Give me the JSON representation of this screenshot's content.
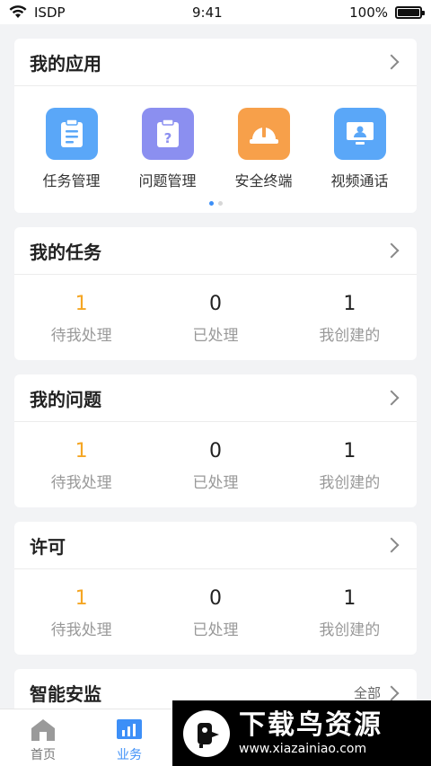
{
  "status": {
    "carrier": "ISDP",
    "time": "9:41",
    "battery": "100%"
  },
  "apps_card": {
    "title": "我的应用",
    "apps": [
      {
        "label": "任务管理",
        "icon": "clipboard-list-icon",
        "color": "#5aa7f8"
      },
      {
        "label": "问题管理",
        "icon": "clipboard-question-icon",
        "color": "#8b8ff0"
      },
      {
        "label": "安全终端",
        "icon": "hard-hat-icon",
        "color": "#f7a04a"
      },
      {
        "label": "视频通话",
        "icon": "monitor-user-icon",
        "color": "#5aa7f8"
      }
    ],
    "page_count": 2,
    "active_page": 0
  },
  "tasks_card": {
    "title": "我的任务",
    "stats": [
      {
        "value": "1",
        "label": "待我处理"
      },
      {
        "value": "0",
        "label": "已处理"
      },
      {
        "value": "1",
        "label": "我创建的"
      }
    ]
  },
  "issues_card": {
    "title": "我的问题",
    "stats": [
      {
        "value": "1",
        "label": "待我处理"
      },
      {
        "value": "0",
        "label": "已处理"
      },
      {
        "value": "1",
        "label": "我创建的"
      }
    ]
  },
  "permit_card": {
    "title": "许可",
    "stats": [
      {
        "value": "1",
        "label": "待我处理"
      },
      {
        "value": "0",
        "label": "已处理"
      },
      {
        "value": "1",
        "label": "我创建的"
      }
    ]
  },
  "monitor_card": {
    "title": "智能安监",
    "more_label": "全部"
  },
  "tabbar": {
    "tabs": [
      {
        "label": "首页",
        "icon": "home-icon"
      },
      {
        "label": "业务",
        "icon": "chart-bars-icon"
      }
    ],
    "active": "业务"
  },
  "watermark": {
    "title": "下载鸟资源",
    "url": "www.xiazainiao.com"
  },
  "colors": {
    "accent": "#3d8ff7",
    "highlight": "#f5a623",
    "background": "#f2f3f5"
  }
}
